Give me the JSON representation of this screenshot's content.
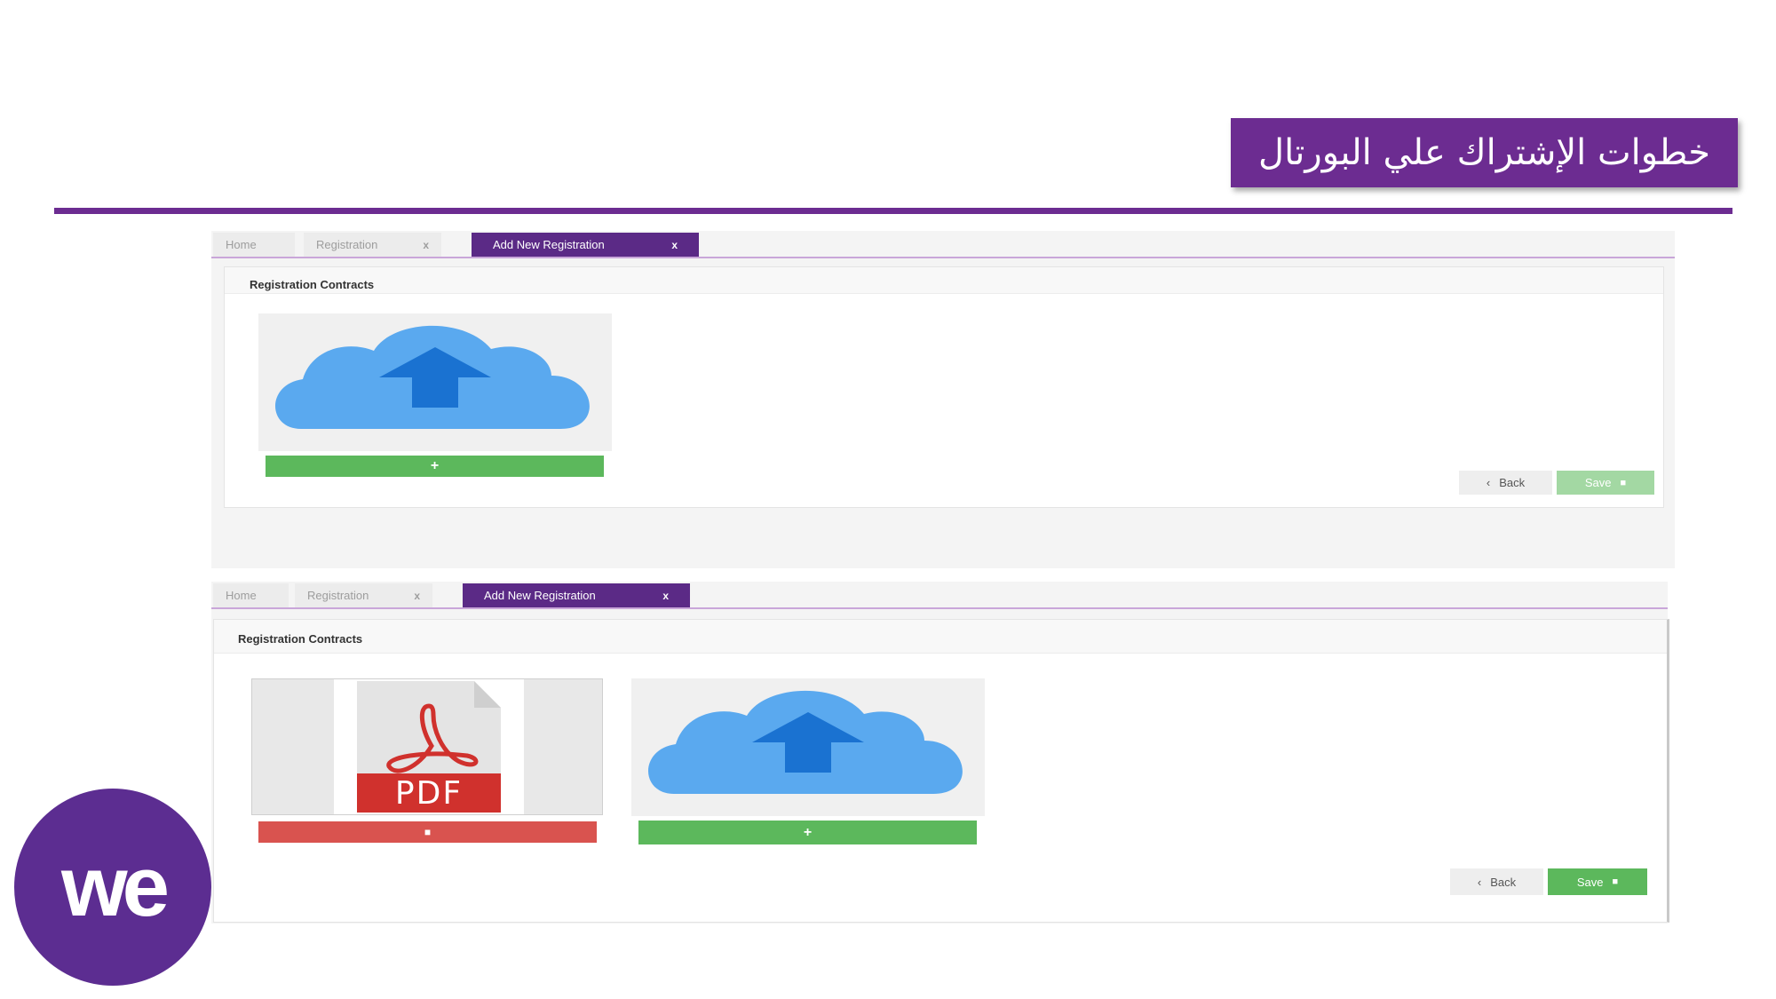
{
  "slide": {
    "title": "خطوات الإشتراك علي البورتال",
    "logo_text": "we",
    "accent_color": "#6c2c91"
  },
  "screens": [
    {
      "tabs": [
        {
          "label": "Home"
        },
        {
          "label": "Registration",
          "close": "x"
        },
        {
          "label": "Add New Registration",
          "close": "x",
          "active": true
        }
      ],
      "section_title": "Registration Contracts",
      "upload_add_label": "+",
      "back_label": "Back",
      "save_label": "Save",
      "save_state": "disabled"
    },
    {
      "tabs": [
        {
          "label": "Home"
        },
        {
          "label": "Registration",
          "close": "x"
        },
        {
          "label": "Add New Registration",
          "close": "x",
          "active": true
        }
      ],
      "section_title": "Registration Contracts",
      "pdf_label": "PDF",
      "delete_label": "■",
      "upload_add_label": "+",
      "back_label": "Back",
      "save_label": "Save",
      "save_state": "enabled"
    }
  ]
}
